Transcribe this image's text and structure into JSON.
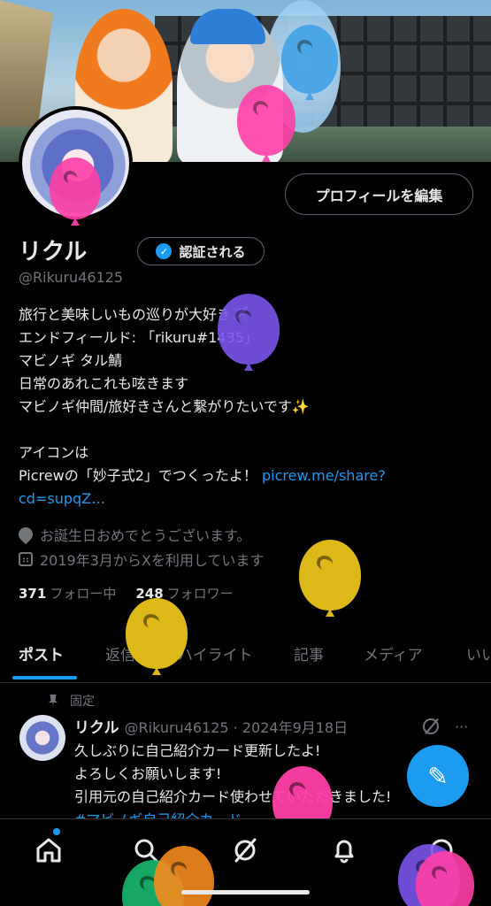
{
  "profile": {
    "edit_button": "プロフィールを編集",
    "name": "リクル",
    "verify_button": "認証される",
    "handle": "@Rikuru46125",
    "bio_lines": [
      "旅行と美味しいもの巡りが大好き✈️",
      "エンドフィールド: 「rikuru#1435」",
      "マビノギ タル鯖",
      "日常のあれこれも呟きます",
      "マビノギ仲間/旅好きさんと繋がりたいです✨"
    ],
    "bio_line6": "アイコンは",
    "bio_line7_text": "Picrewの「妙子式2」でつくったよ！ ",
    "bio_link_1": "picrew.me/share?",
    "bio_link_2": "cd=supqZ…",
    "birthday": "お誕生日おめでとうございます。",
    "joined": "2019年3月からXを利用しています",
    "following_count": "371",
    "following_label": "フォロー中",
    "followers_count": "248",
    "followers_label": "フォロワー"
  },
  "tabs": [
    "ポスト",
    "返信",
    "ハイライト",
    "記事",
    "メディア",
    "いい"
  ],
  "active_tab": "ポスト",
  "pinned_post": {
    "pinned_label": "固定",
    "author": "リクル",
    "handle_date": "@Rikuru46125 · 2024年9月18日",
    "more": "···",
    "lines": [
      "久しぶりに自己紹介カード更新したよ!",
      "よろしくお願いします!",
      "引用元の自己紹介カード使わせていただきました!"
    ],
    "hashtag": "#マビノギ自己紹介カード"
  },
  "fab_icon": "compose-icon",
  "nav_icons": [
    "home-icon",
    "search-icon",
    "grok-icon",
    "bell-icon",
    "messages-icon"
  ],
  "colors": {
    "accent": "#1d9bf0",
    "text": "#e7e9ea",
    "muted": "#71767b",
    "border": "#2f3336"
  }
}
